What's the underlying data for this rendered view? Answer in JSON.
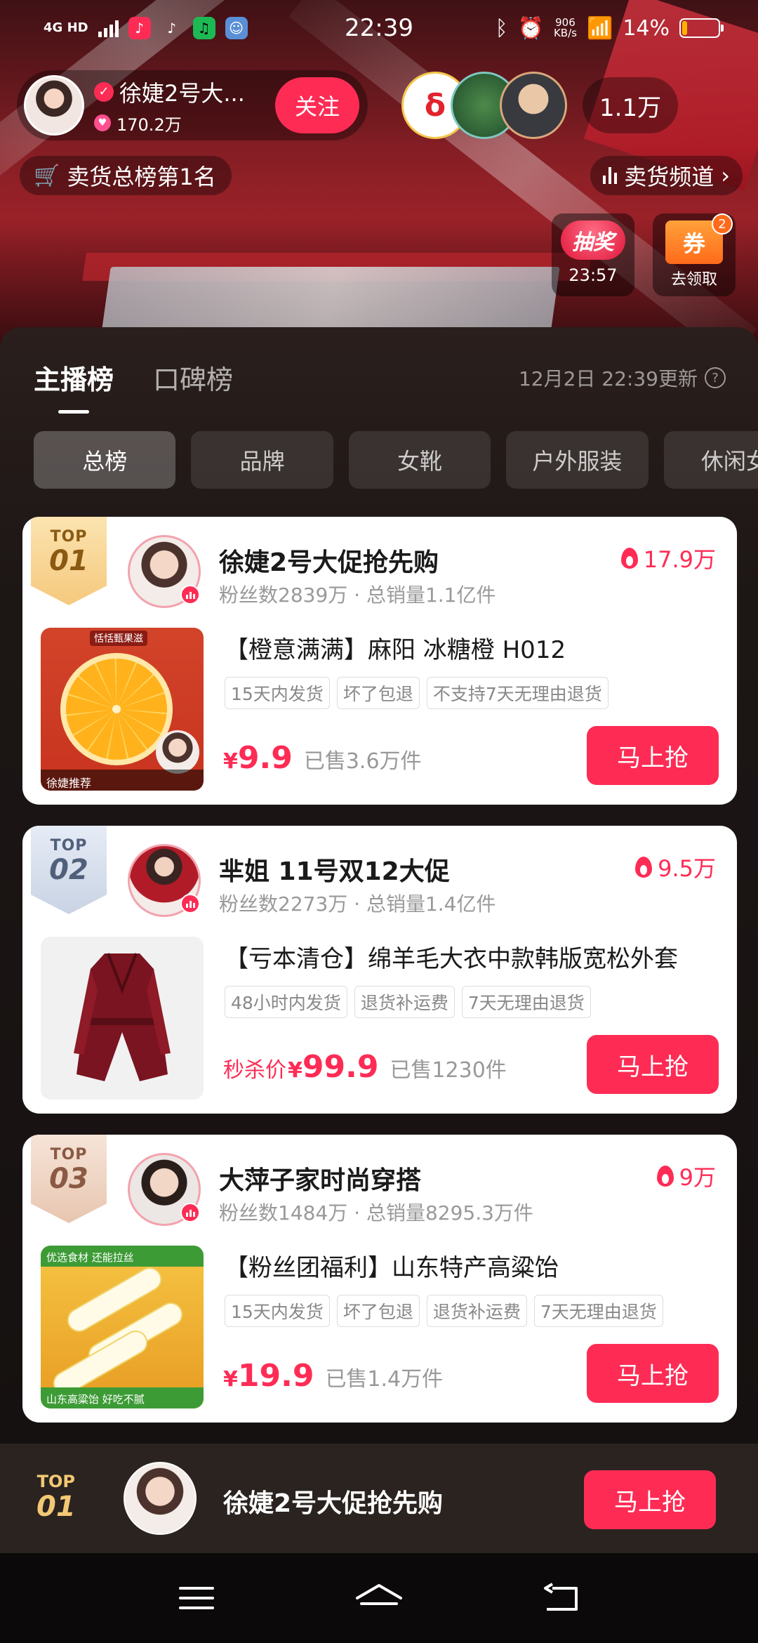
{
  "status_bar": {
    "network": "4G HD",
    "time": "22:39",
    "net_speed_value": "906",
    "net_speed_unit": "KB/s",
    "battery": "14%",
    "battery_level": 0.14
  },
  "streamer": {
    "name": "徐婕2号大...",
    "likes": "170.2万",
    "follow_label": "关注"
  },
  "viewers": {
    "count": "1.1万"
  },
  "rank_badge_top": "卖货总榜第1名",
  "channel_link": "卖货频道",
  "lottery": {
    "label": "抽奖",
    "countdown": "23:57"
  },
  "coupon": {
    "icon_label": "券",
    "label": "去领取",
    "count": "2"
  },
  "panel": {
    "tabs": [
      {
        "label": "主播榜",
        "active": true
      },
      {
        "label": "口碑榜",
        "active": false
      }
    ],
    "update_time": "12月2日 22:39更新",
    "categories": [
      {
        "label": "总榜",
        "active": true
      },
      {
        "label": "品牌",
        "active": false
      },
      {
        "label": "女靴",
        "active": false
      },
      {
        "label": "户外服装",
        "active": false
      },
      {
        "label": "休闲女",
        "active": false
      }
    ]
  },
  "cards": [
    {
      "rank_top": "TOP",
      "rank_num": "01",
      "title": "徐婕2号大促抢先购",
      "sub": "粉丝数2839万 · 总销量1.1亿件",
      "hot": "17.9万",
      "product_title": "【橙意满满】麻阳 冰糖橙 H012",
      "product_img_top": "恬恬甄果滋",
      "product_img_bottom": "徐婕推荐",
      "tags": [
        "15天内发货",
        "坏了包退",
        "不支持7天无理由退货"
      ],
      "price_prefix": "",
      "yen": "¥",
      "price": "9.9",
      "sold": "已售3.6万件",
      "buy": "马上抢"
    },
    {
      "rank_top": "TOP",
      "rank_num": "02",
      "title": "芈姐 11号双12大促",
      "sub": "粉丝数2273万 · 总销量1.4亿件",
      "hot": "9.5万",
      "product_title": "【亏本清仓】绵羊毛大衣中款韩版宽松外套",
      "tags": [
        "48小时内发货",
        "退货补运费",
        "7天无理由退货"
      ],
      "price_prefix": "秒杀价",
      "yen": "¥",
      "price": "99.9",
      "sold": "已售1230件",
      "buy": "马上抢"
    },
    {
      "rank_top": "TOP",
      "rank_num": "03",
      "title": "大萍子家时尚穿搭",
      "sub": "粉丝数1484万 · 总销量8295.3万件",
      "hot": "9万",
      "product_title": "【粉丝团福利】山东特产高粱饴",
      "product_img_top": "优选食材 还能拉丝",
      "product_img_bottom": "山东高粱饴 好吃不腻",
      "tags": [
        "15天内发货",
        "坏了包退",
        "退货补运费",
        "7天无理由退货"
      ],
      "price_prefix": "",
      "yen": "¥",
      "price": "19.9",
      "sold": "已售1.4万件",
      "buy": "马上抢"
    }
  ],
  "sticky": {
    "rank_top": "TOP",
    "rank_num": "01",
    "title": "徐婕2号大促抢先购",
    "buy": "马上抢"
  },
  "colors": {
    "accent": "#fe2c55",
    "gold": "#f6c97d",
    "panel_bg": "#1c1615"
  },
  "icons": {
    "nav_menu": "menu-icon",
    "nav_home": "home-icon",
    "nav_back": "back-icon"
  }
}
